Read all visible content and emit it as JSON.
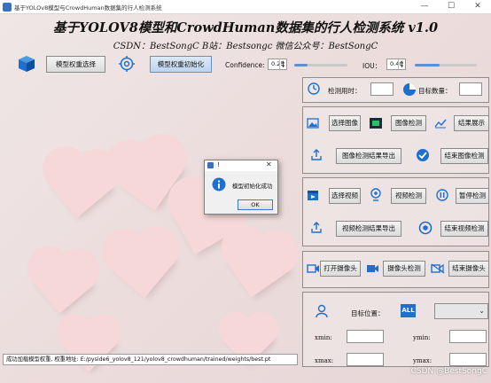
{
  "window": {
    "title": "基于YOLOv8模型与CrowdHuman数据集的行人检测系统",
    "min_glyph": "—",
    "max_glyph": "☐",
    "close_glyph": "✕"
  },
  "header": {
    "title": "基于YOLOV8模型和CrowdHuman数据集的行人检测系统 v1.0",
    "subtitle": "CSDN：BestSongC    B站：Bestsongc    微信公众号：BestSongC"
  },
  "toolbar": {
    "model_select_label": "模型权重选择",
    "model_init_label": "模型权重初始化",
    "confidence_label": "Confidence:",
    "confidence_value": "0.25",
    "iou_label": "IOU：",
    "iou_value": "0.40",
    "confidence_fraction": 0.25,
    "iou_fraction": 0.4
  },
  "stats": {
    "time_label": "检测用时：",
    "time_value": "",
    "count_label": "目标数量：",
    "count_value": ""
  },
  "image_section": {
    "select_label": "选择图像",
    "detect_label": "图像检测",
    "show_label": "结果展示",
    "export_label": "图像检测结果导出",
    "end_label": "结束图像检测"
  },
  "video_section": {
    "select_label": "选择视频",
    "detect_label": "视频检测",
    "pause_label": "暂停检测",
    "export_label": "视频检测结果导出",
    "end_label": "结束视频检测"
  },
  "camera_section": {
    "open_label": "打开摄像头",
    "detect_label": "摄像头检测",
    "end_label": "结束摄像头"
  },
  "target_section": {
    "position_label": "目标位置：",
    "all_badge": "ALL",
    "select_value": "",
    "xmin_label": "xmin:",
    "ymin_label": "ymin:",
    "xmax_label": "xmax:",
    "ymax_label": "ymax:"
  },
  "dialog": {
    "title": "!",
    "message": "模型初始化成功",
    "ok_label": "OK",
    "close_glyph": "✕"
  },
  "status_bar": {
    "text": "成功加载模型权重, 权重地址: E:/pyside6_yolov8_121/yolov8_crowdhuman/trained/weights/best.pt"
  },
  "watermark": "CSDN @BestSongC",
  "colors": {
    "accent_blue": "#1e6fd0",
    "heart_pink": "#f6d8d8",
    "background": "#ecdcdc"
  }
}
